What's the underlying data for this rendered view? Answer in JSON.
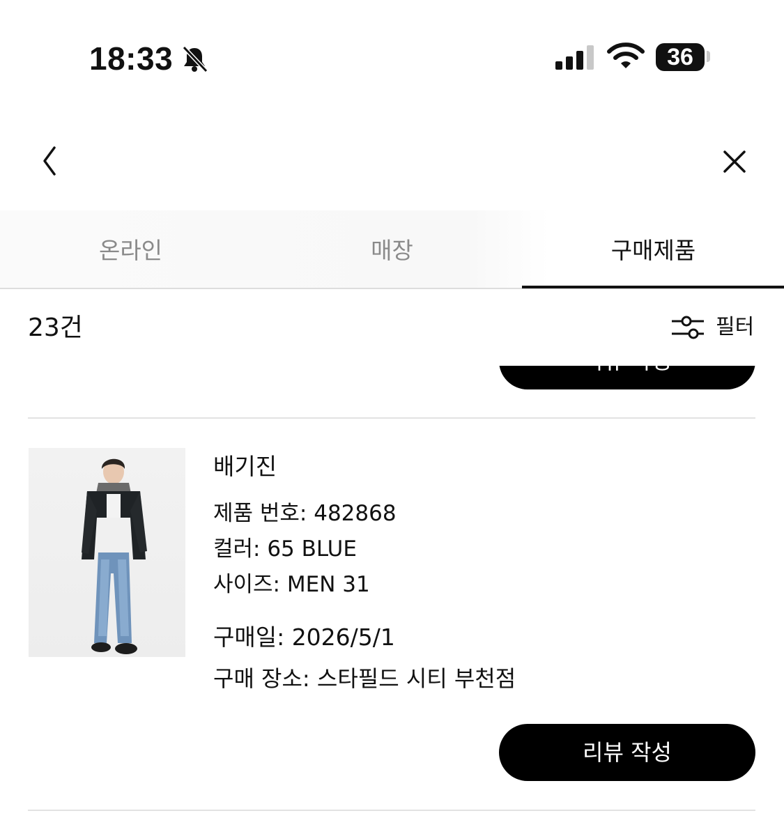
{
  "status_bar": {
    "time": "18:33",
    "battery": "36",
    "icons": [
      "bell-slash-icon",
      "signal-icon",
      "wifi-icon",
      "battery-icon"
    ]
  },
  "header": {
    "back_icon": "chevron-left-icon",
    "close_icon": "close-icon"
  },
  "tabs": [
    {
      "label": "온라인",
      "active": false
    },
    {
      "label": "매장",
      "active": false
    },
    {
      "label": "구매제품",
      "active": true
    }
  ],
  "list": {
    "count": "23건",
    "filter_label": "필터",
    "filter_icon": "sliders-icon"
  },
  "product": {
    "name": "배기진",
    "number_line": "제품 번호: 482868",
    "color_line": "컬러: 65 BLUE",
    "size_line": "사이즈: MEN 31",
    "date_line": "구매일: 2026/5/1",
    "place_line": "구매 장소: 스타필드 시티 부천점",
    "review_button": "리뷰 작성"
  },
  "colors": {
    "accent": "#000000",
    "inactive_tab": "#8a8a8a",
    "divider": "#e2e2e2"
  }
}
